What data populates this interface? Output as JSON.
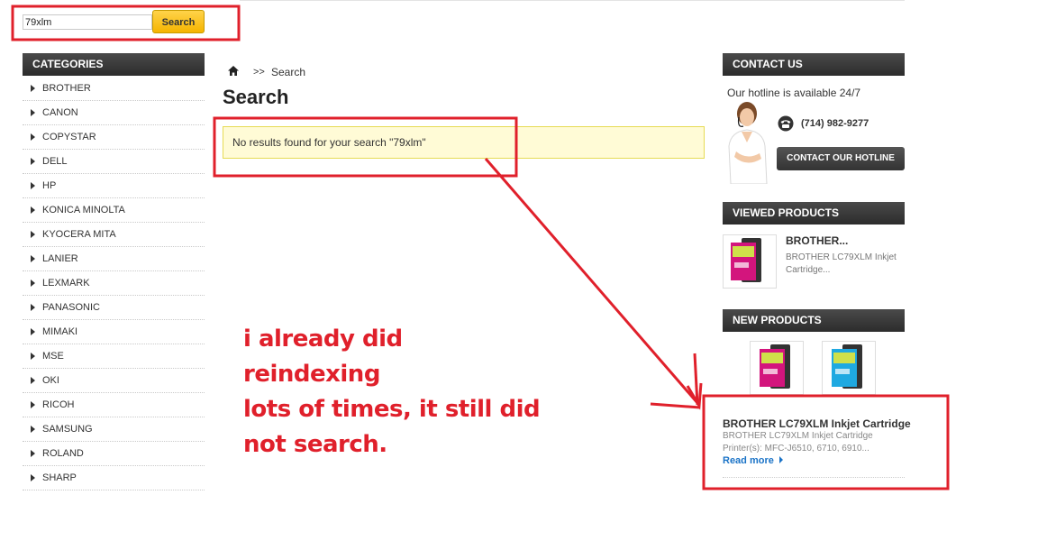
{
  "search": {
    "value": "79xlm",
    "button_label": "Search"
  },
  "categories": {
    "title": "CATEGORIES",
    "items": [
      "BROTHER",
      "CANON",
      "COPYSTAR",
      "DELL",
      "HP",
      "KONICA MINOLTA",
      "KYOCERA MITA",
      "LANIER",
      "LEXMARK",
      "PANASONIC",
      "MIMAKI",
      "MSE",
      "OKI",
      "RICOH",
      "SAMSUNG",
      "ROLAND",
      "SHARP"
    ]
  },
  "breadcrumb": {
    "separator": ">>",
    "current": "Search"
  },
  "main": {
    "title": "Search",
    "notice": "No results found for your search \"79xlm\""
  },
  "contact": {
    "title": "CONTACT US",
    "hotline_text": "Our hotline is available 24/7",
    "phone": "(714) 982-9277",
    "button_label": "CONTACT OUR HOTLINE"
  },
  "viewed_products": {
    "title": "VIEWED PRODUCTS",
    "item": {
      "name": "BROTHER...",
      "desc": "BROTHER LC79XLM Inkjet Cartridge..."
    }
  },
  "new_products": {
    "title": "NEW PRODUCTS",
    "item": {
      "name": "BROTHER LC79XLM Inkjet Cartridge",
      "desc_line1": "BROTHER LC79XLM Inkjet Cartridge",
      "desc_line2": "Printer(s): MFC-J6510, 6710, 6910...",
      "read_more": "Read more"
    }
  },
  "annotation": {
    "text": "i already did reindexing\nlots of times, it still did\nnot search."
  },
  "colors": {
    "annotation_red": "#e0202b",
    "accent_yellow": "#f5b400",
    "link_blue": "#1a73c7"
  }
}
